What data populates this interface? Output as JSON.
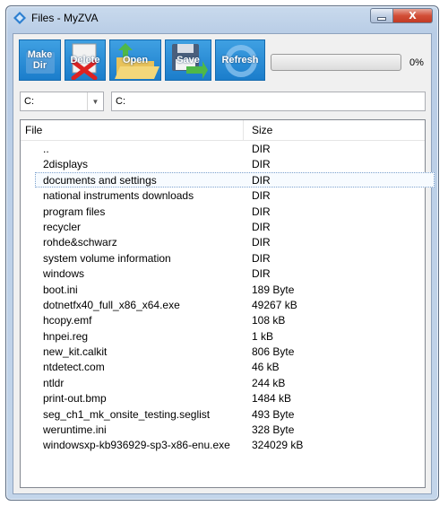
{
  "window": {
    "title": "Files - MyZVA",
    "icon": "diamond-app-icon",
    "minimize_icon": "minimize-icon",
    "close_label": "X"
  },
  "toolbar": {
    "make_dir_label_line1": "Make",
    "make_dir_label_line2": "Dir",
    "delete_label": "Delete",
    "open_label": "Open",
    "save_label": "Save",
    "refresh_label": "Refresh",
    "progress_fraction": 0,
    "progress_text": "0%",
    "accent_color": "#1f86d2"
  },
  "drive": {
    "selected": "C:"
  },
  "path": {
    "value": "C:"
  },
  "list": {
    "columns": {
      "file": "File",
      "size": "Size"
    },
    "rows": [
      {
        "name": "..",
        "size": "DIR"
      },
      {
        "name": "2displays",
        "size": "DIR"
      },
      {
        "name": "documents and settings",
        "size": "DIR"
      },
      {
        "name": "national instruments downloads",
        "size": "DIR"
      },
      {
        "name": "program files",
        "size": "DIR"
      },
      {
        "name": "recycler",
        "size": "DIR"
      },
      {
        "name": "rohde&schwarz",
        "size": "DIR"
      },
      {
        "name": "system volume information",
        "size": "DIR"
      },
      {
        "name": "windows",
        "size": "DIR"
      },
      {
        "name": "boot.ini",
        "size": "189 Byte"
      },
      {
        "name": "dotnetfx40_full_x86_x64.exe",
        "size": "49267 kB"
      },
      {
        "name": "hcopy.emf",
        "size": "108 kB"
      },
      {
        "name": "hnpei.reg",
        "size": "1 kB"
      },
      {
        "name": "new_kit.calkit",
        "size": "806 Byte"
      },
      {
        "name": "ntdetect.com",
        "size": "46 kB"
      },
      {
        "name": "ntldr",
        "size": "244 kB"
      },
      {
        "name": "print-out.bmp",
        "size": "1484 kB"
      },
      {
        "name": "seg_ch1_mk_onsite_testing.seglist",
        "size": "493 Byte"
      },
      {
        "name": "weruntime.ini",
        "size": "328 Byte"
      },
      {
        "name": "windowsxp-kb936929-sp3-x86-enu.exe",
        "size": "324029 kB"
      }
    ],
    "selected_index": 2
  }
}
